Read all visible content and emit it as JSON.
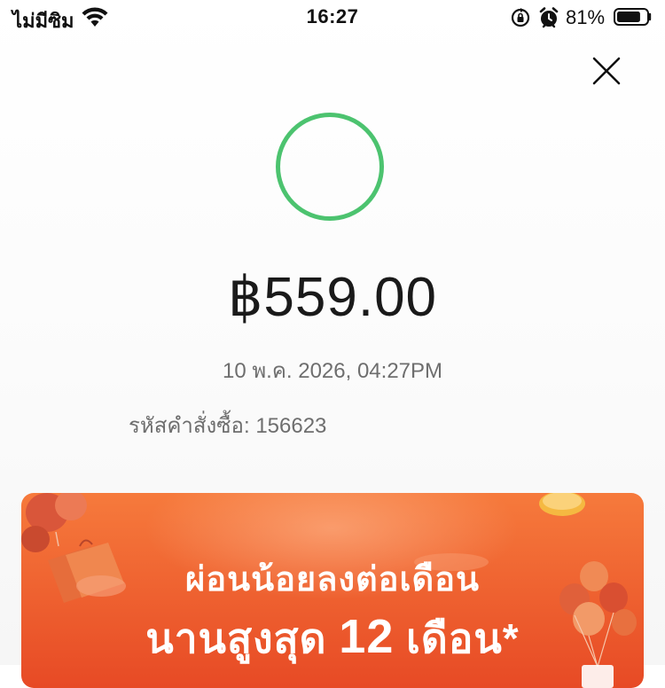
{
  "status_bar": {
    "carrier": "ไม่มีซิม",
    "time": "16:27",
    "battery_percent": "81%",
    "battery_level": 0.81
  },
  "receipt": {
    "amount": "฿559.00",
    "datetime": "10 พ.ค. 2026, 04:27PM",
    "order_label": "รหัสคำสั่งซื้อ:",
    "order_number": "156623"
  },
  "banner": {
    "line1": "ผ่อนน้อยลงต่อเดือน",
    "line2_prefix": "นานสูงสุด",
    "line2_number": "12",
    "line2_suffix": "เดือน*"
  },
  "colors": {
    "success_ring": "#4CC36F",
    "banner_top": "#f67a3c",
    "banner_bottom": "#e74a25"
  },
  "icons": [
    "wifi-icon",
    "rotation-lock-icon",
    "alarm-icon",
    "battery-icon",
    "close-icon"
  ]
}
